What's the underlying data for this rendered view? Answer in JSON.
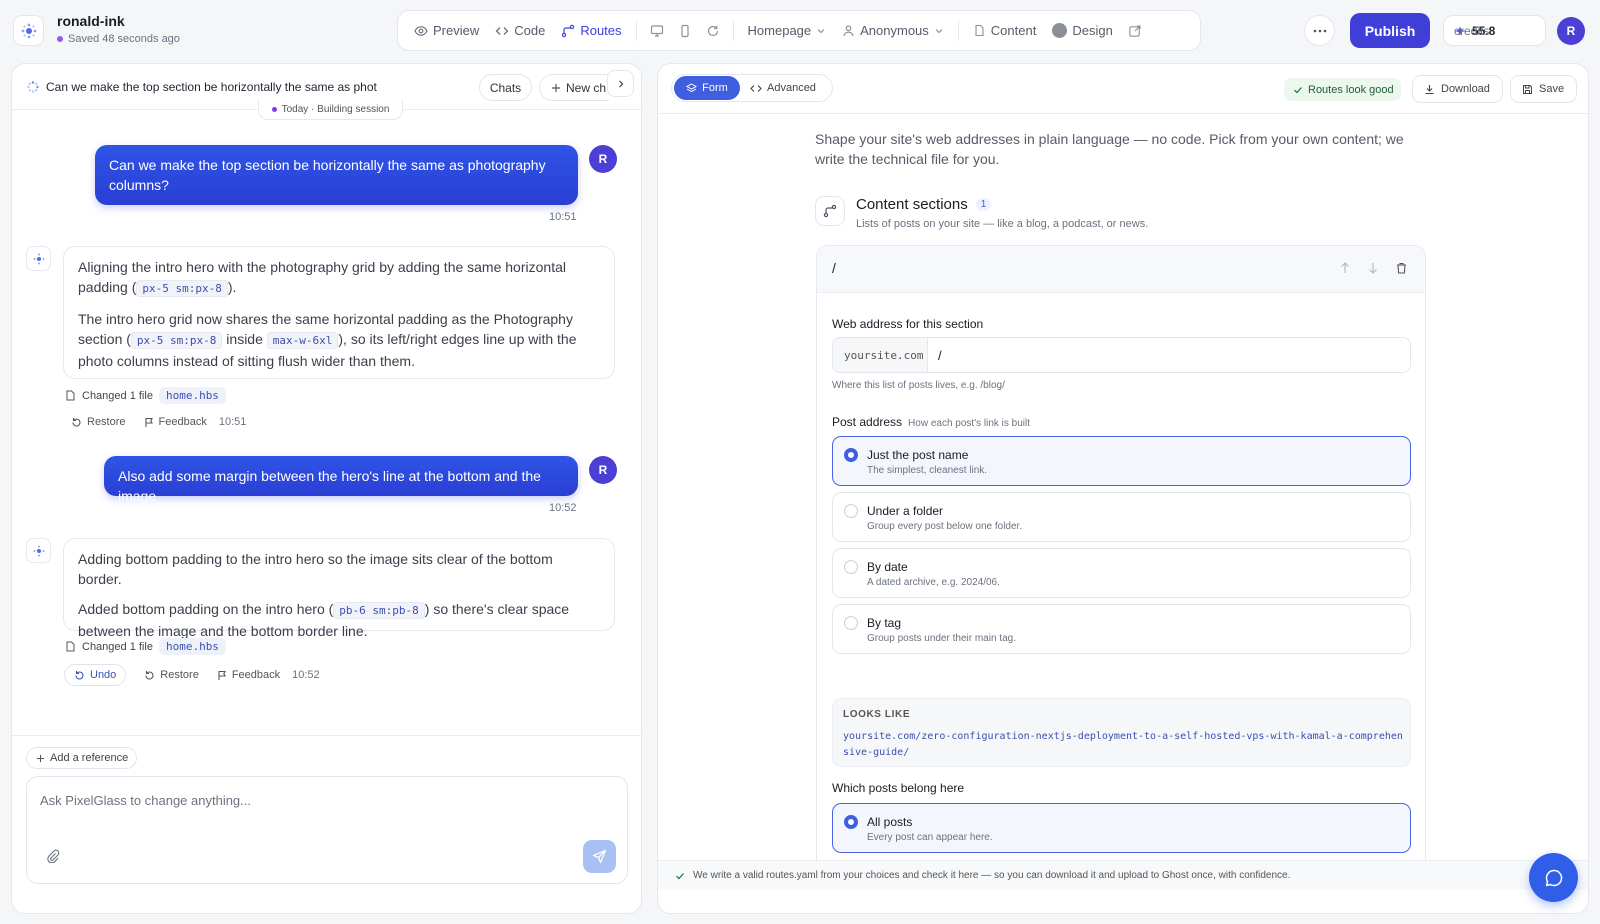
{
  "app": {
    "project_name": "ronald-ink",
    "saved_status": "Saved 48 seconds ago"
  },
  "toolbar": {
    "preview": "Preview",
    "code": "Code",
    "routes": "Routes",
    "page_select": "Homepage",
    "user_select": "Anonymous",
    "content": "Content",
    "design": "Design"
  },
  "header": {
    "publish": "Publish",
    "credits_value": "55.8",
    "credits_label": "credits",
    "avatar_initial": "R"
  },
  "chat": {
    "title": "Can we make the top section be horizontally the same as phot",
    "chats_button": "Chats",
    "new_chat_button": "New ch",
    "session_label": "Today · Building session",
    "messages": [
      {
        "user_text": "Can we make the top section be horizontally the same as photography columns?",
        "time": "10:51"
      },
      {
        "bot_summary_pre": "Aligning the intro hero with the photography grid by adding the same horizontal padding (",
        "bot_summary_code": "px-5 sm:px-8",
        "bot_summary_post": ").",
        "bot_detail_pre": "The intro hero grid now shares the same horizontal padding as the Photography section (",
        "bot_detail_code1": "px-5 sm:px-8",
        "bot_detail_mid": " inside ",
        "bot_detail_code2": "max-w-6xl",
        "bot_detail_post": "), so its left/right edges line up with the photo columns instead of sitting flush wider than them.",
        "changed_label": "Changed 1 file",
        "file": "home.hbs",
        "restore": "Restore",
        "feedback": "Feedback",
        "time": "10:51"
      },
      {
        "user_text": "Also add some margin between the hero's line at the bottom and the image",
        "time": "10:52"
      },
      {
        "bot_summary": "Adding bottom padding to the intro hero so the image sits clear of the bottom border.",
        "bot_detail_pre": "Added bottom padding on the intro hero (",
        "bot_detail_code": "pb-6 sm:pb-8",
        "bot_detail_post": ") so there's clear space between the image and the bottom border line.",
        "changed_label": "Changed 1 file",
        "file": "home.hbs",
        "undo": "Undo",
        "restore": "Restore",
        "feedback": "Feedback",
        "time": "10:52"
      }
    ],
    "add_reference": "Add a reference",
    "composer_placeholder": "Ask PixelGlass to change anything..."
  },
  "routes_panel": {
    "tab_form": "Form",
    "tab_advanced": "Advanced",
    "status": "Routes look good",
    "download": "Download",
    "save": "Save",
    "intro": "Shape your site's web addresses in plain language — no code. Pick from your own content; we write the technical file for you.",
    "section_title": "Content sections",
    "section_count": "1",
    "section_subtitle": "Lists of posts on your site — like a blog, a podcast, or news.",
    "card_path": "/",
    "web_address_label": "Web address for this section",
    "domain_prefix": "yoursite.com",
    "path_value": "/",
    "web_address_help": "Where this list of posts lives, e.g. /blog/",
    "post_address_label": "Post address",
    "post_address_hint": "How each post's link is built",
    "options": [
      {
        "title": "Just the post name",
        "desc": "The simplest, cleanest link."
      },
      {
        "title": "Under a folder",
        "desc": "Group every post below one folder."
      },
      {
        "title": "By date",
        "desc": "A dated archive, e.g. 2024/06."
      },
      {
        "title": "By tag",
        "desc": "Group posts under their main tag."
      }
    ],
    "looks_like_label": "LOOKS LIKE",
    "looks_like_value": "yoursite.com/zero-configuration-nextjs-deployment-to-a-self-hosted-vps-with-kamal-a-comprehensive-guide/",
    "which_posts_label": "Which posts belong here",
    "which_options": [
      {
        "title": "All posts",
        "desc": "Every post can appear here."
      }
    ],
    "footer": "We write a valid routes.yaml from your choices and check it here — so you can download it and upload to Ghost once, with confidence."
  },
  "colors": {
    "accent": "#3f3fd8",
    "user_bubble": "#2f47dc",
    "success_bg": "#ecf7ee"
  }
}
